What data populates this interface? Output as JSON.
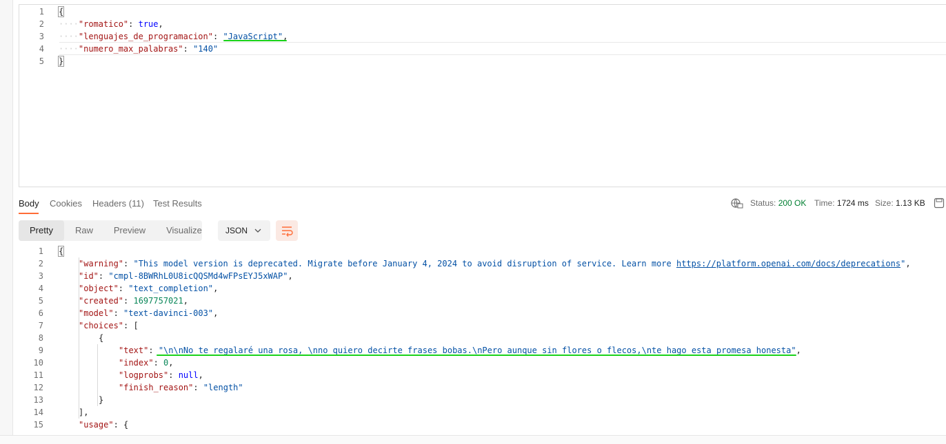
{
  "request": {
    "lines": [
      {
        "n": "1",
        "parts": [
          {
            "t": "{",
            "c": "punc"
          }
        ]
      },
      {
        "n": "2",
        "dots": "····",
        "parts": [
          {
            "t": "\"romatico\"",
            "c": "key"
          },
          {
            "t": ": ",
            "c": "punc"
          },
          {
            "t": "true",
            "c": "bool"
          },
          {
            "t": ",",
            "c": "punc"
          }
        ]
      },
      {
        "n": "3",
        "dots": "····",
        "parts": [
          {
            "t": "\"lenguajes_de_programacion\"",
            "c": "key"
          },
          {
            "t": ": ",
            "c": "punc"
          },
          {
            "t": "\"JavaScript\"",
            "c": "str"
          },
          {
            "t": ",",
            "c": "punc"
          }
        ]
      },
      {
        "n": "4",
        "dots": "····",
        "parts": [
          {
            "t": "\"numero_max_palabras\"",
            "c": "key"
          },
          {
            "t": ": ",
            "c": "punc"
          },
          {
            "t": "\"140\"",
            "c": "str"
          }
        ]
      },
      {
        "n": "5",
        "parts": [
          {
            "t": "}",
            "c": "punc"
          }
        ]
      }
    ]
  },
  "tabs": {
    "body": "Body",
    "cookies": "Cookies",
    "headers": "Headers (11)",
    "tests": "Test Results"
  },
  "status": {
    "status_label": "Status:",
    "status_value": "200 OK",
    "time_label": "Time:",
    "time_value": "1724 ms",
    "size_label": "Size:",
    "size_value": "1.13 KB"
  },
  "view": {
    "pretty": "Pretty",
    "raw": "Raw",
    "preview": "Preview",
    "visualize": "Visualize",
    "format": "JSON"
  },
  "response": {
    "lines": [
      {
        "n": "1",
        "indent": 0,
        "parts": [
          {
            "t": "{",
            "c": "punc"
          }
        ]
      },
      {
        "n": "2",
        "indent": 1,
        "parts": [
          {
            "t": "\"warning\"",
            "c": "key"
          },
          {
            "t": ": ",
            "c": "punc"
          },
          {
            "t": "\"This model version is deprecated. Migrate before January 4, 2024 to avoid disruption of service. Learn more ",
            "c": "str"
          },
          {
            "t": "https://platform.openai.com/docs/deprecations",
            "c": "link"
          },
          {
            "t": "\"",
            "c": "str"
          },
          {
            "t": ",",
            "c": "punc"
          }
        ]
      },
      {
        "n": "3",
        "indent": 1,
        "parts": [
          {
            "t": "\"id\"",
            "c": "key"
          },
          {
            "t": ": ",
            "c": "punc"
          },
          {
            "t": "\"cmpl-8BWRhL0U8icQQSMd4wFPsEYJ5xWAP\"",
            "c": "str"
          },
          {
            "t": ",",
            "c": "punc"
          }
        ]
      },
      {
        "n": "4",
        "indent": 1,
        "parts": [
          {
            "t": "\"object\"",
            "c": "key"
          },
          {
            "t": ": ",
            "c": "punc"
          },
          {
            "t": "\"text_completion\"",
            "c": "str"
          },
          {
            "t": ",",
            "c": "punc"
          }
        ]
      },
      {
        "n": "5",
        "indent": 1,
        "parts": [
          {
            "t": "\"created\"",
            "c": "key"
          },
          {
            "t": ": ",
            "c": "punc"
          },
          {
            "t": "1697757021",
            "c": "num"
          },
          {
            "t": ",",
            "c": "punc"
          }
        ]
      },
      {
        "n": "6",
        "indent": 1,
        "parts": [
          {
            "t": "\"model\"",
            "c": "key"
          },
          {
            "t": ": ",
            "c": "punc"
          },
          {
            "t": "\"text-davinci-003\"",
            "c": "str"
          },
          {
            "t": ",",
            "c": "punc"
          }
        ]
      },
      {
        "n": "7",
        "indent": 1,
        "parts": [
          {
            "t": "\"choices\"",
            "c": "key"
          },
          {
            "t": ": [",
            "c": "punc"
          }
        ]
      },
      {
        "n": "8",
        "indent": 2,
        "parts": [
          {
            "t": "{",
            "c": "punc"
          }
        ]
      },
      {
        "n": "9",
        "indent": 3,
        "parts": [
          {
            "t": "\"text\"",
            "c": "key"
          },
          {
            "t": ": ",
            "c": "punc"
          },
          {
            "t": "\"\\n\\nNo te regalaré una rosa, \\nno quiero decirte frases bobas.\\nPero aunque sin flores o flecos,\\nte hago esta promesa honesta\"",
            "c": "str"
          },
          {
            "t": ",",
            "c": "punc"
          }
        ]
      },
      {
        "n": "10",
        "indent": 3,
        "parts": [
          {
            "t": "\"index\"",
            "c": "key"
          },
          {
            "t": ": ",
            "c": "punc"
          },
          {
            "t": "0",
            "c": "num"
          },
          {
            "t": ",",
            "c": "punc"
          }
        ]
      },
      {
        "n": "11",
        "indent": 3,
        "parts": [
          {
            "t": "\"logprobs\"",
            "c": "key"
          },
          {
            "t": ": ",
            "c": "punc"
          },
          {
            "t": "null",
            "c": "bool"
          },
          {
            "t": ",",
            "c": "punc"
          }
        ]
      },
      {
        "n": "12",
        "indent": 3,
        "parts": [
          {
            "t": "\"finish_reason\"",
            "c": "key"
          },
          {
            "t": ": ",
            "c": "punc"
          },
          {
            "t": "\"length\"",
            "c": "str"
          }
        ]
      },
      {
        "n": "13",
        "indent": 2,
        "parts": [
          {
            "t": "}",
            "c": "punc"
          }
        ]
      },
      {
        "n": "14",
        "indent": 1,
        "parts": [
          {
            "t": "],",
            "c": "punc"
          }
        ]
      },
      {
        "n": "15",
        "indent": 1,
        "parts": [
          {
            "t": "\"usage\"",
            "c": "key"
          },
          {
            "t": ": {",
            "c": "punc"
          }
        ]
      }
    ]
  },
  "icons": {
    "globe": "network-globe-icon",
    "save": "save-response-icon",
    "wrap": "wrap-lines-icon",
    "chevron": "chevron-down-icon"
  },
  "colors": {
    "accent": "#ff6c37",
    "highlight": "#19d219",
    "status_ok": "#007f31"
  }
}
